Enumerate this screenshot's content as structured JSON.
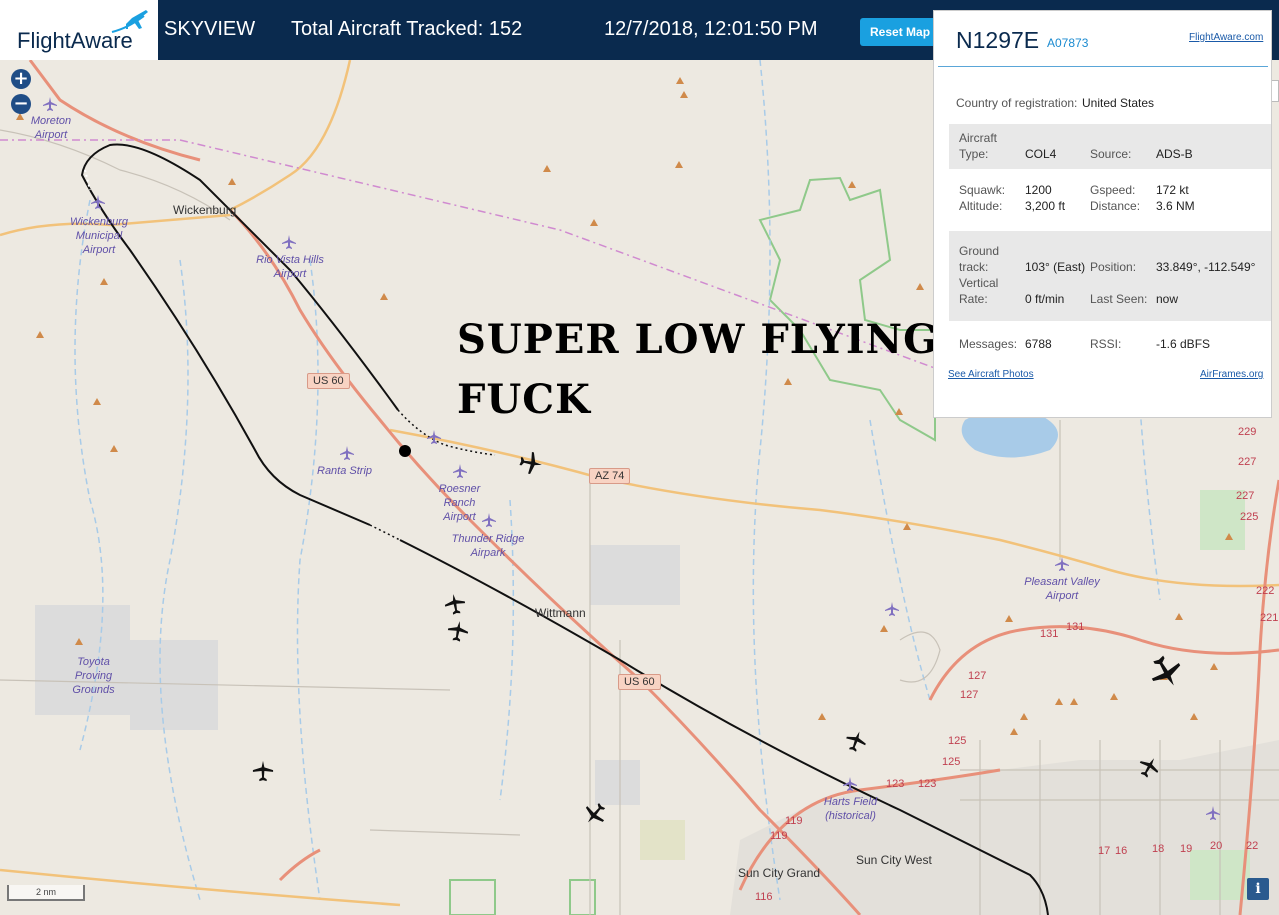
{
  "header": {
    "logo": "FlightAware",
    "app_name": "SKYVIEW",
    "total_tracked": "Total Aircraft Tracked: 152",
    "datetime": "12/7/2018, 12:01:50 PM",
    "reset_label": "Reset Map"
  },
  "map": {
    "zoom_in": "+",
    "zoom_out": "−",
    "caption_line1": "SUPER LOW FLYING",
    "caption_line2": "FUCK",
    "places": [
      "Wickenburg",
      "Wittmann",
      "Sun City West",
      "Sun City Grand"
    ],
    "airports": [
      "Moreton Airport",
      "Wickenburg Municipal Airport",
      "Rio Vista Hills Airport",
      "Ranta Strip",
      "Roesner Ranch Airport",
      "Thunder Ridge Airpark",
      "Toyota Proving Grounds",
      "Pleasant Valley Airport",
      "Harts Field (historical)"
    ],
    "shields": [
      "US 60",
      "AZ 74",
      "US 60"
    ],
    "road_numbers": [
      "229",
      "227",
      "227",
      "225",
      "222",
      "221",
      "131",
      "131",
      "127",
      "127",
      "125",
      "125",
      "123",
      "123",
      "119",
      "119",
      "116",
      "17",
      "16",
      "18",
      "19",
      "20",
      "22"
    ],
    "scale": "2 nm",
    "info": "i"
  },
  "aircraft": {
    "registration": "N1297E",
    "hex": "A07873",
    "link_flightaware": "FlightAware.com",
    "country_label": "Country of registration:",
    "country": "United States",
    "type_label": "Aircraft Type:",
    "type": "COL4",
    "source_label": "Source:",
    "source": "ADS-B",
    "squawk_label": "Squawk:",
    "squawk": "1200",
    "gspeed_label": "Gspeed:",
    "gspeed": "172 kt",
    "altitude_label": "Altitude:",
    "altitude": "3,200 ft",
    "distance_label": "Distance:",
    "distance": "3.6 NM",
    "ground_track_label": "Ground track:",
    "ground_track": "103° (East)",
    "position_label": "Position:",
    "position": "33.849°, -112.549°",
    "vrate_label": "Vertical Rate:",
    "vrate": "0 ft/min",
    "last_seen_label": "Last Seen:",
    "last_seen": "now",
    "messages_label": "Messages:",
    "messages": "6788",
    "rssi_label": "RSSI:",
    "rssi": "-1.6 dBFS",
    "photos_link": "See Aircraft Photos",
    "airframes_link": "AirFrames.org"
  },
  "colors": {
    "header_bg": "#0a2a4e",
    "accent": "#1aa0e0",
    "map_bg": "#ede9e1",
    "highway": "#e8907a",
    "state_road": "#f2c27a",
    "water": "#a8cbe8",
    "park_border": "#8fc98a",
    "track": "#000000"
  }
}
